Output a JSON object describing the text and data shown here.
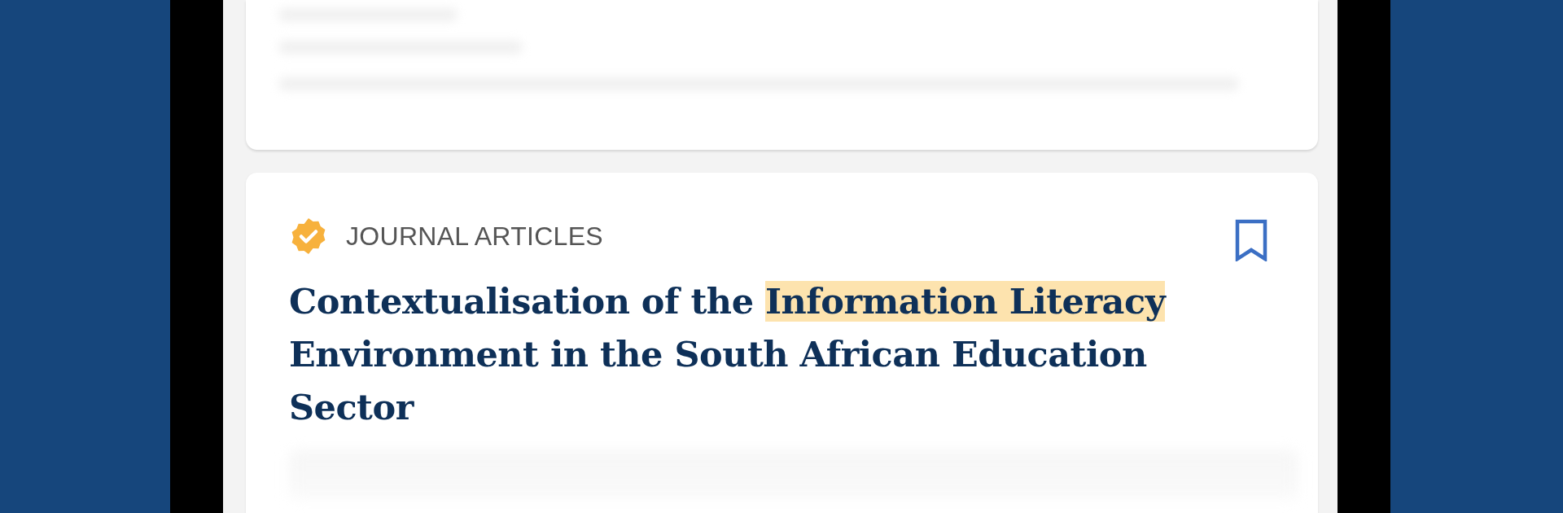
{
  "cards": [
    {
      "kind": "blurred"
    },
    {
      "kind": "article",
      "verified": true,
      "category": "JOURNAL ARTICLES",
      "bookmarked": false,
      "title": [
        {
          "text": "Contextualisation of the ",
          "highlighted": false
        },
        {
          "text": "Information Literacy",
          "highlighted": true
        },
        {
          "text": " Environment in the South African Education Sector",
          "highlighted": false
        }
      ]
    }
  ]
}
